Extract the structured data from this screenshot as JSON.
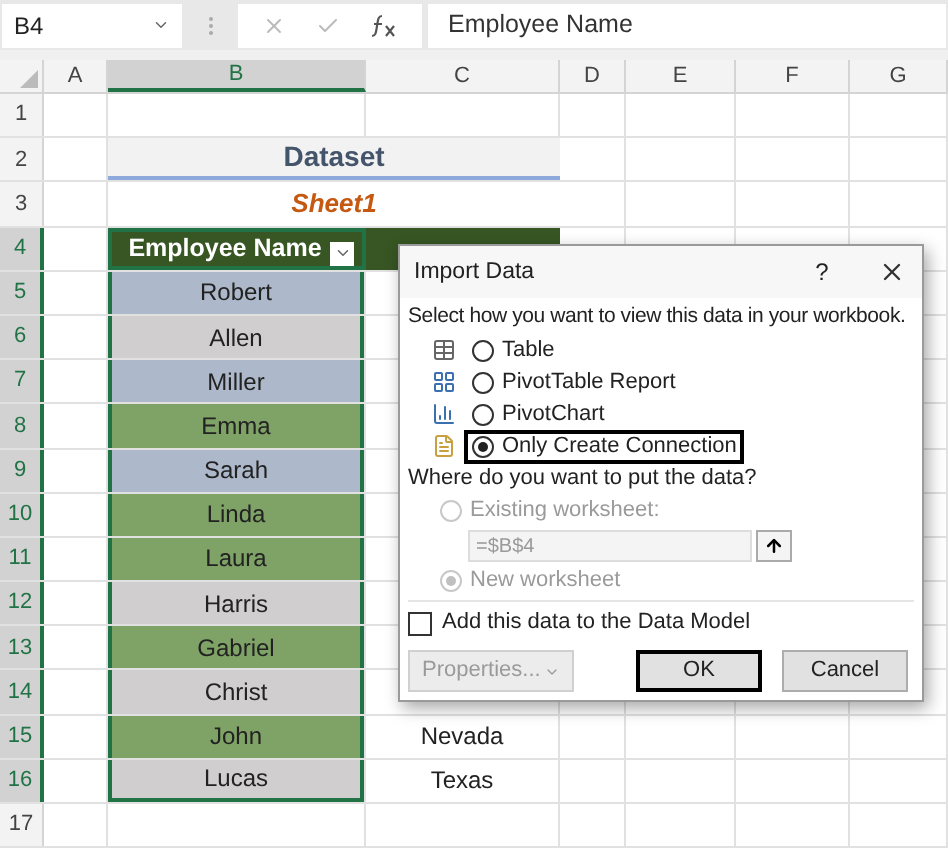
{
  "formula_bar": {
    "name_box": "B4",
    "formula": "Employee Name"
  },
  "columns": [
    {
      "label": "A",
      "selected": false
    },
    {
      "label": "B",
      "selected": true
    },
    {
      "label": "C",
      "selected": false
    },
    {
      "label": "D",
      "selected": false
    },
    {
      "label": "E",
      "selected": false
    },
    {
      "label": "F",
      "selected": false
    },
    {
      "label": "G",
      "selected": false
    }
  ],
  "rows": [
    {
      "label": "1",
      "selected": false
    },
    {
      "label": "2",
      "selected": false
    },
    {
      "label": "3",
      "selected": false
    },
    {
      "label": "4",
      "selected": true
    },
    {
      "label": "5",
      "selected": true
    },
    {
      "label": "6",
      "selected": true
    },
    {
      "label": "7",
      "selected": true
    },
    {
      "label": "8",
      "selected": true
    },
    {
      "label": "9",
      "selected": true
    },
    {
      "label": "10",
      "selected": true
    },
    {
      "label": "11",
      "selected": true
    },
    {
      "label": "12",
      "selected": true
    },
    {
      "label": "13",
      "selected": true
    },
    {
      "label": "14",
      "selected": true
    },
    {
      "label": "15",
      "selected": true
    },
    {
      "label": "16",
      "selected": true
    },
    {
      "label": "17",
      "selected": false
    }
  ],
  "title": "Dataset",
  "subtitle": "Sheet1",
  "table": {
    "header": "Employee Name",
    "names": [
      {
        "text": "Robert",
        "color": "#adb9ca"
      },
      {
        "text": "Allen",
        "color": "#d0cece"
      },
      {
        "text": "Miller",
        "color": "#adb9ca"
      },
      {
        "text": "Emma",
        "color": "#7fa266"
      },
      {
        "text": "Sarah",
        "color": "#adb9ca"
      },
      {
        "text": "Linda",
        "color": "#7fa266"
      },
      {
        "text": "Laura",
        "color": "#7fa266"
      },
      {
        "text": "Harris",
        "color": "#d0cece"
      },
      {
        "text": "Gabriel",
        "color": "#7fa266"
      },
      {
        "text": "Christ",
        "color": "#d0cece"
      },
      {
        "text": "John",
        "color": "#7fa266",
        "state": "Nevada"
      },
      {
        "text": "Lucas",
        "color": "#d0cece",
        "state": "Texas"
      }
    ]
  },
  "dialog": {
    "title": "Import Data",
    "help": "?",
    "view_prompt": "Select how you want to view this data in your workbook.",
    "view_options": [
      {
        "label": "Table",
        "kind": "table",
        "selected": false
      },
      {
        "label": "PivotTable Report",
        "kind": "pivot",
        "selected": false
      },
      {
        "label": "PivotChart",
        "kind": "chart",
        "selected": false
      },
      {
        "label": "Only Create Connection",
        "kind": "connection",
        "selected": true
      }
    ],
    "place_prompt": "Where do you want to put the data?",
    "place_options": [
      {
        "label": "Existing worksheet:",
        "selected": false,
        "disabled": true
      },
      {
        "label": "New worksheet",
        "selected": true,
        "disabled": true
      }
    ],
    "range": {
      "value": "=$B$4",
      "disabled": true
    },
    "data_model": {
      "label": "Add this data to the Data Model",
      "checked": false
    },
    "buttons": [
      {
        "label": "Properties...",
        "kind": "dropdown",
        "disabled": true
      },
      {
        "label": "OK",
        "kind": "default",
        "disabled": false
      },
      {
        "label": "Cancel",
        "kind": "plain",
        "disabled": false
      }
    ]
  }
}
